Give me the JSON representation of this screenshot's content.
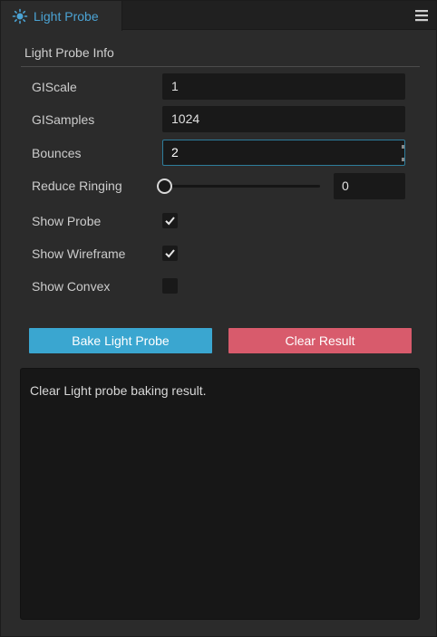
{
  "tab": {
    "title": "Light Probe",
    "icon": "light-probe-icon",
    "menu_icon": "hamburger-menu-icon"
  },
  "section": {
    "title": "Light Probe Info"
  },
  "properties": {
    "gi_scale": {
      "label": "GIScale",
      "value": "1"
    },
    "gi_samples": {
      "label": "GISamples",
      "value": "1024"
    },
    "bounces": {
      "label": "Bounces",
      "value": "2"
    },
    "reduce_ringing": {
      "label": "Reduce Ringing",
      "value": "0",
      "slider_fraction": 0
    },
    "show_probe": {
      "label": "Show Probe",
      "checked": true
    },
    "show_wireframe": {
      "label": "Show Wireframe",
      "checked": true
    },
    "show_convex": {
      "label": "Show Convex",
      "checked": false
    }
  },
  "buttons": {
    "bake": {
      "label": "Bake Light Probe",
      "color": "#3aa6d0"
    },
    "clear": {
      "label": "Clear Result",
      "color": "#d85b6c"
    }
  },
  "result": {
    "message": "Clear Light probe baking result."
  },
  "colors": {
    "accent": "#4ba3d4"
  }
}
